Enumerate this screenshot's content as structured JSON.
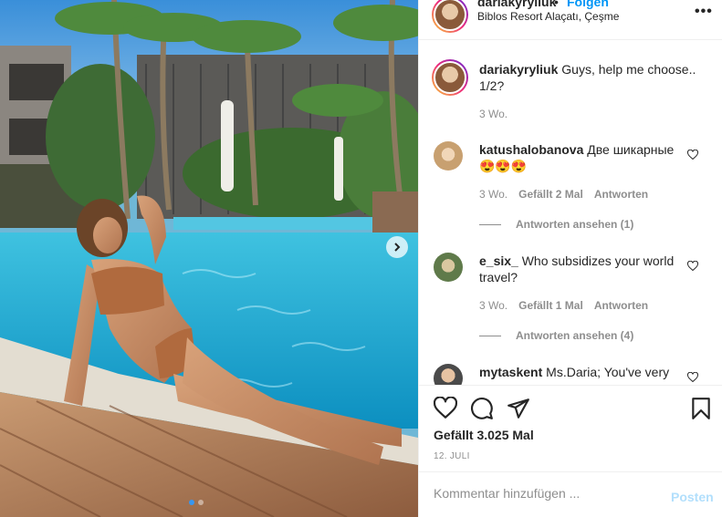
{
  "header": {
    "username": "dariakyryliuk",
    "separator": "•",
    "follow_label": "Folgen",
    "location": "Biblos Resort Alaçatı, Çeşme",
    "more_label": "•••"
  },
  "caption": {
    "username": "dariakyryliuk",
    "text": "Guys, help me choose.. 1/2?",
    "time": "3 Wo."
  },
  "comments": [
    {
      "username": "katushalobanova",
      "text": "Две шикарные 😍😍😍",
      "time": "3 Wo.",
      "likes": "Gefällt 2 Mal",
      "reply_label": "Antworten",
      "view_replies": "Antworten ansehen (1)"
    },
    {
      "username": "e_six_",
      "text": "Who subsidizes your world travel?",
      "time": "3 Wo.",
      "likes": "Gefällt 1 Mal",
      "reply_label": "Antworten",
      "view_replies": "Antworten ansehen (4)"
    },
    {
      "username": "mytaskent",
      "text": "Ms.Daria; You've very"
    }
  ],
  "actions": {
    "likes": "Gefällt 3.025 Mal",
    "date": "12. Juli"
  },
  "add_comment": {
    "placeholder": "Kommentar hinzufügen ...",
    "post_label": "Posten"
  },
  "icons": {
    "like": "heart-icon",
    "comment": "comment-icon",
    "share": "paper-plane-icon",
    "save": "bookmark-icon",
    "carousel_next": "chevron-right-icon"
  },
  "colors": {
    "link_blue": "#0095f6",
    "post_disabled": "#b2dffc",
    "muted": "#8e8e8e",
    "text": "#262626"
  }
}
